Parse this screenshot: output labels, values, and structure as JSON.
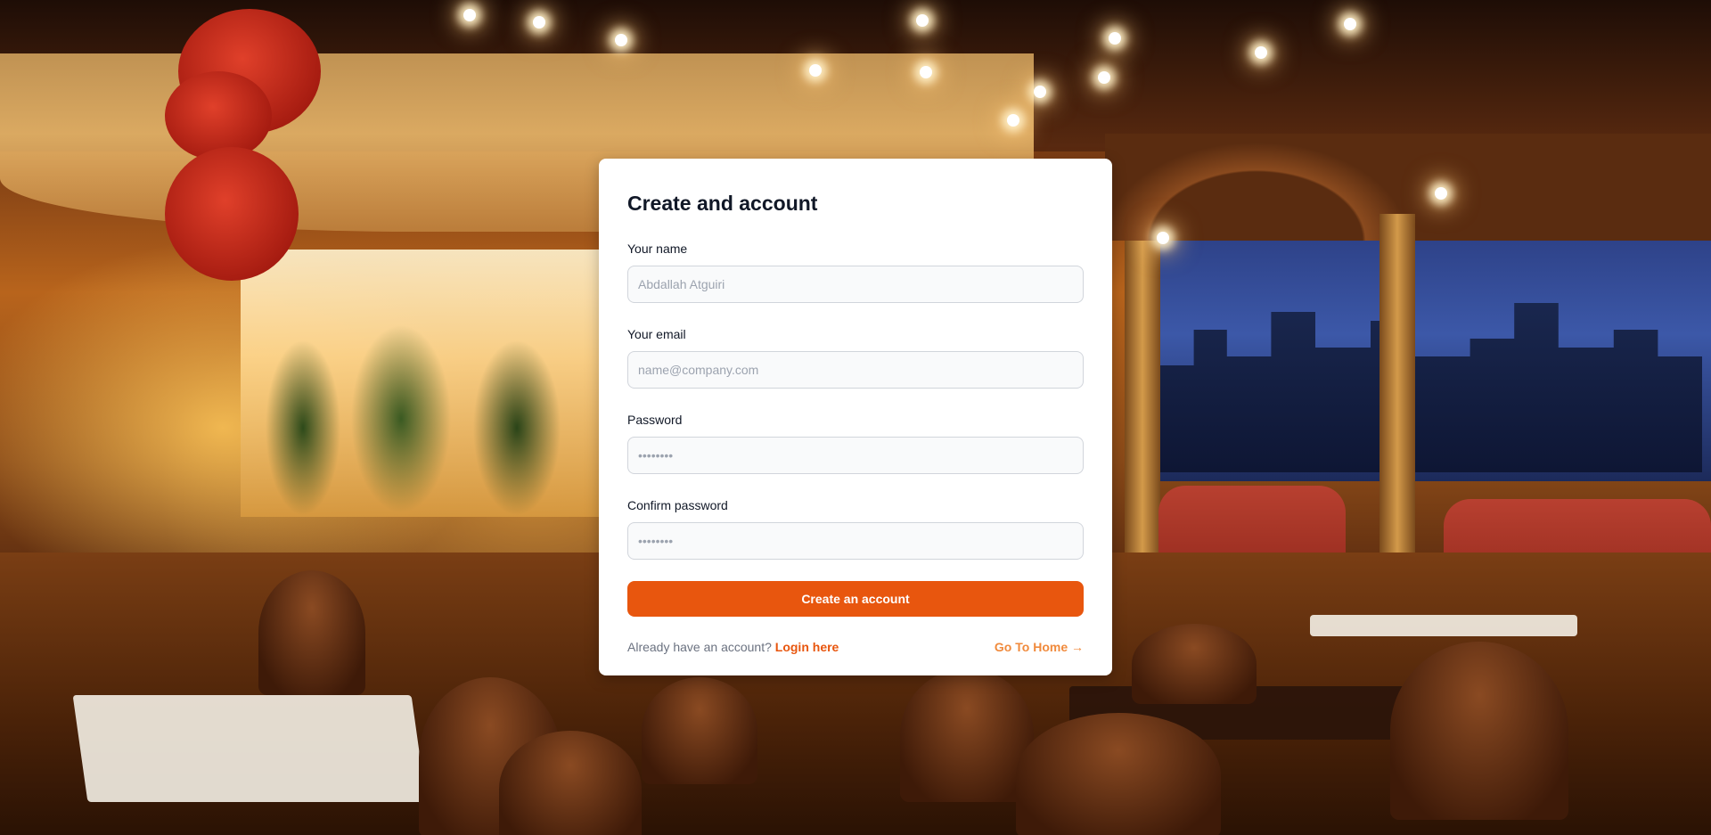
{
  "form": {
    "title": "Create and account",
    "name_label": "Your name",
    "name_placeholder": "Abdallah Atguiri",
    "email_label": "Your email",
    "email_placeholder": "name@company.com",
    "password_label": "Password",
    "password_placeholder": "••••••••",
    "confirm_label": "Confirm password",
    "confirm_placeholder": "••••••••",
    "submit_label": "Create an account",
    "already_text": "Already have an account?",
    "login_link": "Login here",
    "home_link": "Go To Home →"
  },
  "colors": {
    "accent": "#e8560e",
    "card_bg": "#ffffff",
    "input_bg": "#f9fafb"
  }
}
